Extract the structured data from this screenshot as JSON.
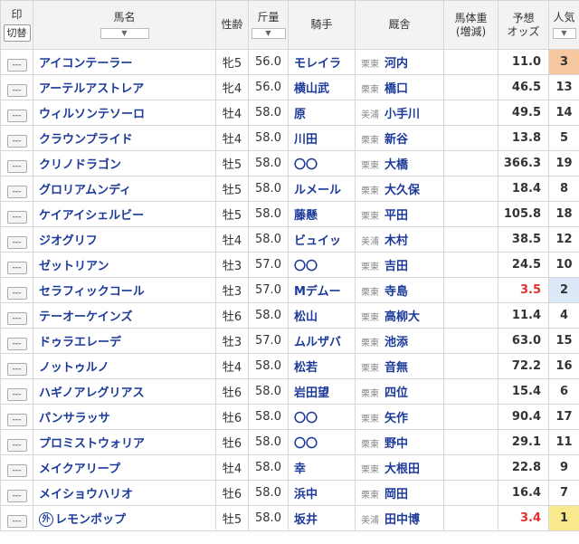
{
  "header": {
    "mark": "印",
    "switch": "切替",
    "horse": "馬名",
    "sex_age": "性齢",
    "weight": "斤量",
    "jockey": "騎手",
    "stable": "厩舎",
    "body_weight_line1": "馬体重",
    "body_weight_line2": "(増減)",
    "odds_line1": "予想",
    "odds_line2": "オッズ",
    "popularity": "人気",
    "sort_icon": "▼"
  },
  "mark_default": "---",
  "rows": [
    {
      "horse": "アイコンテーラー",
      "sex_age": "牝5",
      "weight": "56.0",
      "jockey": "モレイラ",
      "region": "栗東",
      "trainer": "河内",
      "odds": "11.0",
      "pop": "3"
    },
    {
      "horse": "アーテルアストレア",
      "sex_age": "牝4",
      "weight": "56.0",
      "jockey": "横山武",
      "region": "栗東",
      "trainer": "橋口",
      "odds": "46.5",
      "pop": "13"
    },
    {
      "horse": "ウィルソンテソーロ",
      "sex_age": "牡4",
      "weight": "58.0",
      "jockey": "原",
      "region": "美浦",
      "trainer": "小手川",
      "odds": "49.5",
      "pop": "14"
    },
    {
      "horse": "クラウンプライド",
      "sex_age": "牡4",
      "weight": "58.0",
      "jockey": "川田",
      "region": "栗東",
      "trainer": "新谷",
      "odds": "13.8",
      "pop": "5"
    },
    {
      "horse": "クリノドラゴン",
      "sex_age": "牡5",
      "weight": "58.0",
      "jockey": "〇〇",
      "region": "栗東",
      "trainer": "大橋",
      "odds": "366.3",
      "pop": "19"
    },
    {
      "horse": "グロリアムンディ",
      "sex_age": "牡5",
      "weight": "58.0",
      "jockey": "ルメール",
      "region": "栗東",
      "trainer": "大久保",
      "odds": "18.4",
      "pop": "8"
    },
    {
      "horse": "ケイアイシェルビー",
      "sex_age": "牡5",
      "weight": "58.0",
      "jockey": "藤懸",
      "region": "栗東",
      "trainer": "平田",
      "odds": "105.8",
      "pop": "18"
    },
    {
      "horse": "ジオグリフ",
      "sex_age": "牡4",
      "weight": "58.0",
      "jockey": "ビュイッ",
      "region": "美浦",
      "trainer": "木村",
      "odds": "38.5",
      "pop": "12"
    },
    {
      "horse": "ゼットリアン",
      "sex_age": "牡3",
      "weight": "57.0",
      "jockey": "〇〇",
      "region": "栗東",
      "trainer": "吉田",
      "odds": "24.5",
      "pop": "10"
    },
    {
      "horse": "セラフィックコール",
      "sex_age": "牡3",
      "weight": "57.0",
      "jockey": "Mデムー",
      "region": "栗東",
      "trainer": "寺島",
      "odds": "3.5",
      "pop": "2"
    },
    {
      "horse": "テーオーケインズ",
      "sex_age": "牡6",
      "weight": "58.0",
      "jockey": "松山",
      "region": "栗東",
      "trainer": "高柳大",
      "odds": "11.4",
      "pop": "4"
    },
    {
      "horse": "ドゥラエレーデ",
      "sex_age": "牡3",
      "weight": "57.0",
      "jockey": "ムルザバ",
      "region": "栗東",
      "trainer": "池添",
      "odds": "63.0",
      "pop": "15"
    },
    {
      "horse": "ノットゥルノ",
      "sex_age": "牡4",
      "weight": "58.0",
      "jockey": "松若",
      "region": "栗東",
      "trainer": "音無",
      "odds": "72.2",
      "pop": "16"
    },
    {
      "horse": "ハギノアレグリアス",
      "sex_age": "牡6",
      "weight": "58.0",
      "jockey": "岩田望",
      "region": "栗東",
      "trainer": "四位",
      "odds": "15.4",
      "pop": "6"
    },
    {
      "horse": "パンサラッサ",
      "sex_age": "牡6",
      "weight": "58.0",
      "jockey": "〇〇",
      "region": "栗東",
      "trainer": "矢作",
      "odds": "90.4",
      "pop": "17"
    },
    {
      "horse": "プロミストウォリア",
      "sex_age": "牡6",
      "weight": "58.0",
      "jockey": "〇〇",
      "region": "栗東",
      "trainer": "野中",
      "odds": "29.1",
      "pop": "11"
    },
    {
      "horse": "メイクアリープ",
      "sex_age": "牡4",
      "weight": "58.0",
      "jockey": "幸",
      "region": "栗東",
      "trainer": "大根田",
      "odds": "22.8",
      "pop": "9"
    },
    {
      "horse": "メイショウハリオ",
      "sex_age": "牡6",
      "weight": "58.0",
      "jockey": "浜中",
      "region": "栗東",
      "trainer": "岡田",
      "odds": "16.4",
      "pop": "7"
    },
    {
      "horse": "レモンポップ",
      "sex_age": "牡5",
      "weight": "58.0",
      "jockey": "坂井",
      "region": "美浦",
      "trainer": "田中博",
      "odds": "3.4",
      "pop": "1",
      "foreign": "外"
    }
  ],
  "colors": {
    "link": "#1c3a9a",
    "low_odds": "#e03030",
    "pop1": "#f8ea8c",
    "pop2": "#dbe8f8",
    "pop3": "#f7c89f"
  }
}
